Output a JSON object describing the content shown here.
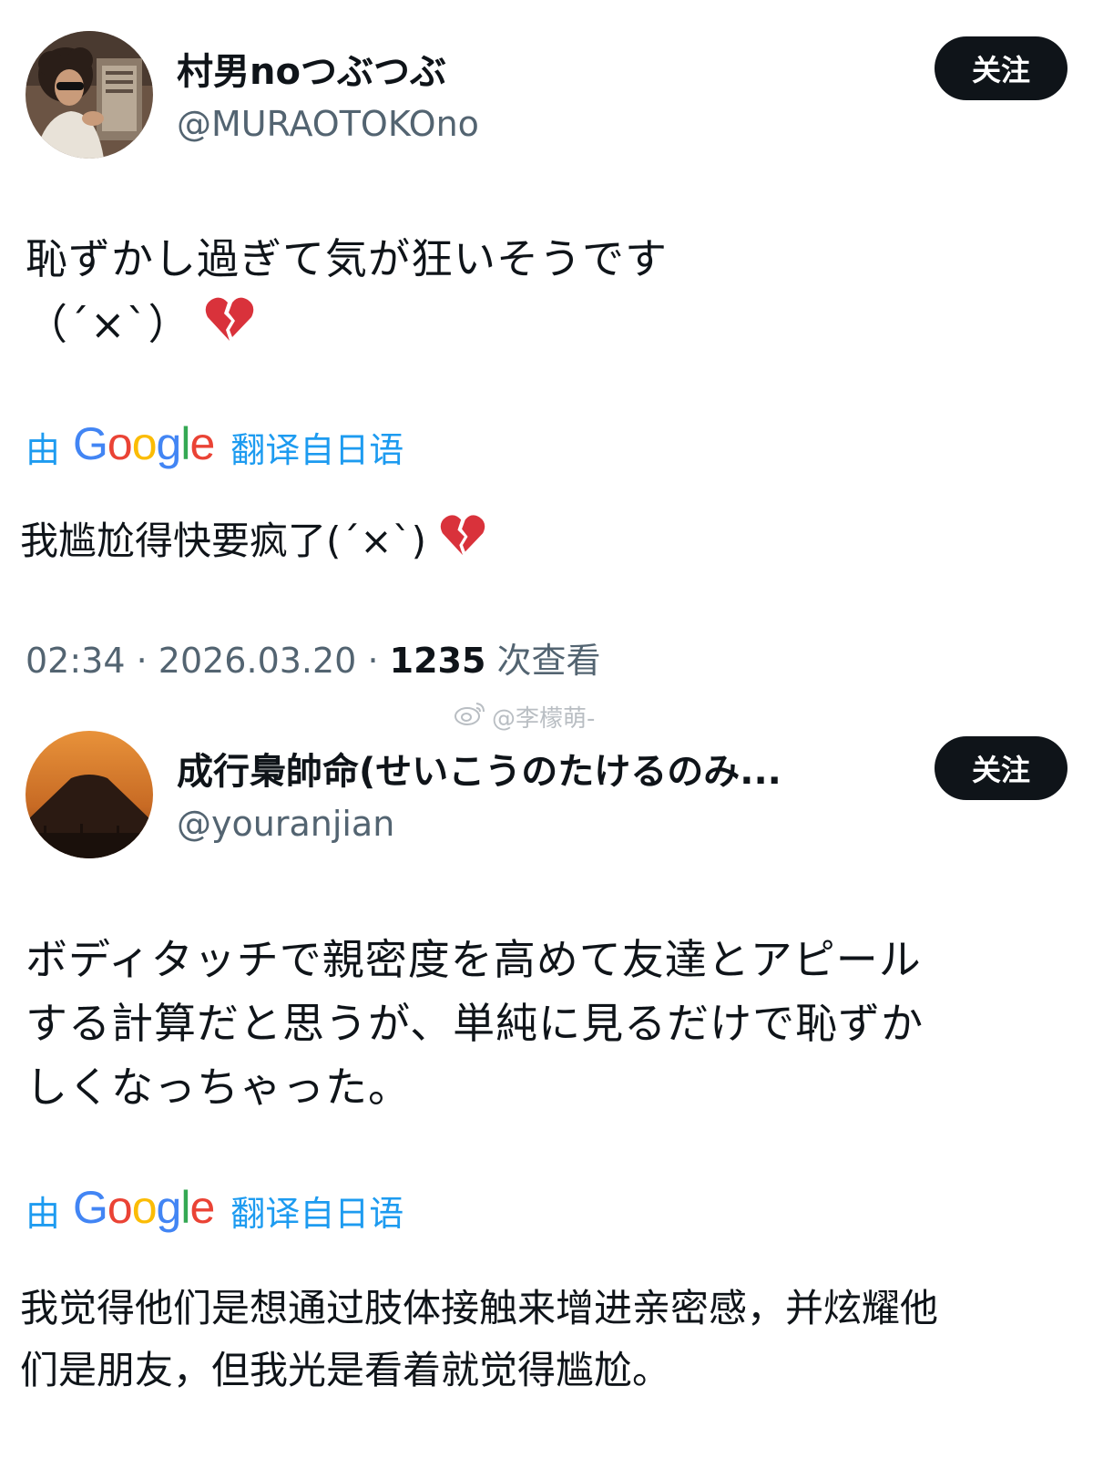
{
  "posts": [
    {
      "author_name": "村男noつぶつぶ",
      "author_handle": "@MURAOTOKOno",
      "follow_label": "关注",
      "text_lines": [
        "恥ずかし過ぎて気が狂いそうです",
        "（´×`）"
      ],
      "translate": {
        "prefix": "由",
        "brand": "Google",
        "suffix": "翻译自日语"
      },
      "translated_text": "我尴尬得快要疯了(´×`)",
      "meta": {
        "time": "02:34",
        "date": "2026.03.20",
        "views": "1235",
        "views_label": "次查看"
      }
    },
    {
      "author_name": "成行梟帥命(せいこうのたけるのみ...",
      "author_handle": "@youranjian",
      "follow_label": "关注",
      "text_lines": [
        "ボディタッチで親密度を高めて友達とアピール",
        "する計算だと思うが、単純に見るだけで恥ずか",
        "しくなっちゃった。"
      ],
      "translate": {
        "prefix": "由",
        "brand": "Google",
        "suffix": "翻译自日语"
      },
      "translated_lines": [
        "我觉得他们是想通过肢体接触来增进亲密感，并炫耀他",
        "们是朋友，但我光是看着就觉得尴尬。"
      ]
    }
  ],
  "watermark": {
    "text": "@李檬萌-"
  },
  "icons": {
    "heart": "broken-heart-icon",
    "weibo": "weibo-icon"
  },
  "colors": {
    "link_blue": "#1d9bf0",
    "text_dark": "#0f1419",
    "text_gray": "#536471",
    "button_bg": "#0f1419",
    "heart_red": "#d9323b"
  }
}
